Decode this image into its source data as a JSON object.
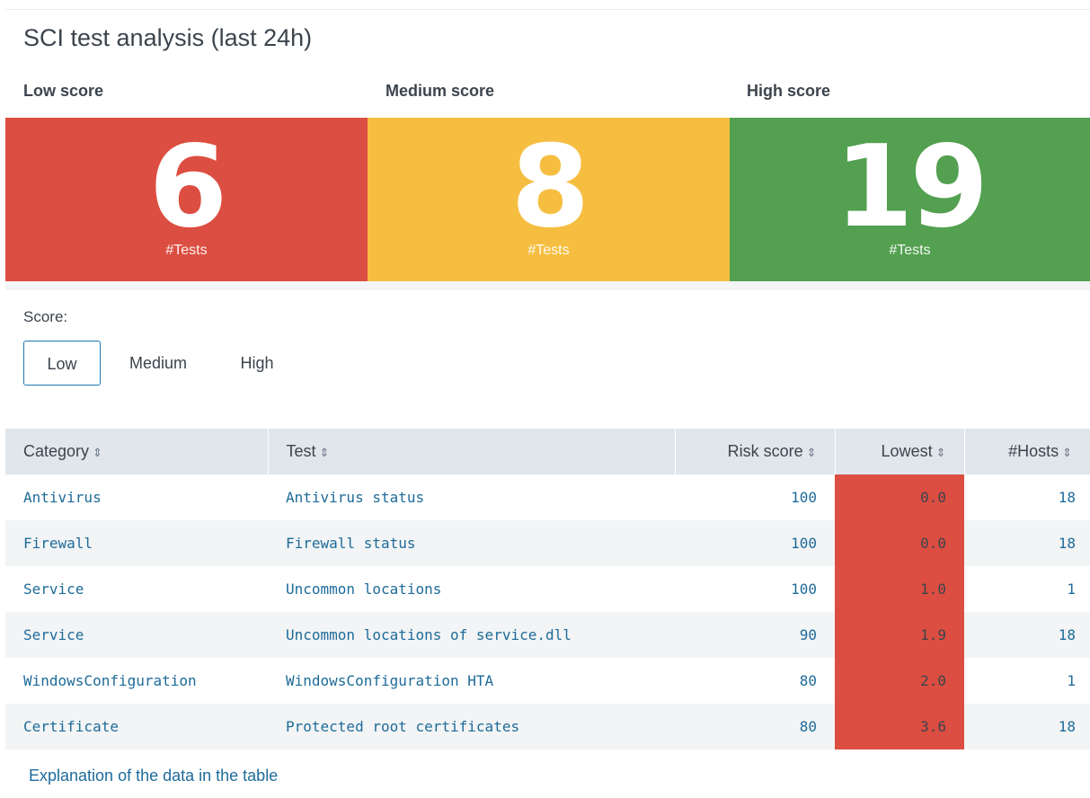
{
  "title": "SCI test analysis (last 24h)",
  "tiles": [
    {
      "label": "Low score",
      "value": "6",
      "sub": "#Tests",
      "color": "#dc4e41"
    },
    {
      "label": "Medium score",
      "value": "8",
      "sub": "#Tests",
      "color": "#f6be41"
    },
    {
      "label": "High score",
      "value": "19",
      "sub": "#Tests",
      "color": "#53a051"
    }
  ],
  "filter": {
    "label": "Score:",
    "options": [
      "Low",
      "Medium",
      "High"
    ],
    "selected": "Low",
    "accent": "#1a7bb4"
  },
  "table": {
    "headers": [
      "Category",
      "Test",
      "Risk score",
      "Lowest",
      "#Hosts"
    ],
    "sort_icon": "⇕",
    "rows": [
      {
        "category": "Antivirus",
        "test": "Antivirus status",
        "risk": "100",
        "lowest": "0.0",
        "hosts": "18"
      },
      {
        "category": "Firewall",
        "test": "Firewall status",
        "risk": "100",
        "lowest": "0.0",
        "hosts": "18"
      },
      {
        "category": "Service",
        "test": "Uncommon locations",
        "risk": "100",
        "lowest": "1.0",
        "hosts": "1"
      },
      {
        "category": "Service",
        "test": "Uncommon locations of service.dll",
        "risk": "90",
        "lowest": "1.9",
        "hosts": "18"
      },
      {
        "category": "WindowsConfiguration",
        "test": "WindowsConfiguration HTA",
        "risk": "80",
        "lowest": "2.0",
        "hosts": "1"
      },
      {
        "category": "Certificate",
        "test": "Protected root certificates",
        "risk": "80",
        "lowest": "3.6",
        "hosts": "18"
      }
    ]
  },
  "footer": {
    "explain_link": "Explanation of the data in the table"
  }
}
